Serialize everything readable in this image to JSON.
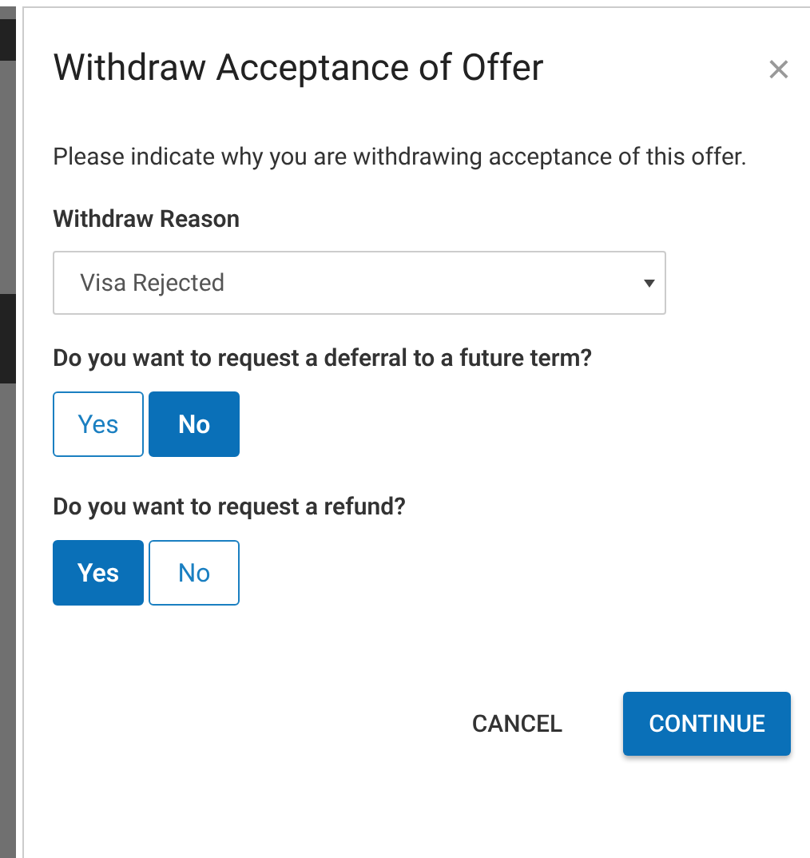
{
  "dialog": {
    "title": "Withdraw Acceptance of Offer",
    "close": "×",
    "intro": "Please indicate why you are withdrawing acceptance of this offer.",
    "reason": {
      "label": "Withdraw Reason",
      "value": "Visa Rejected"
    },
    "questions": [
      {
        "label": "Do you want to request a deferral to a future term?",
        "options": [
          {
            "label": "Yes",
            "selected": false
          },
          {
            "label": "No",
            "selected": true
          }
        ]
      },
      {
        "label": "Do you want to request a refund?",
        "options": [
          {
            "label": "Yes",
            "selected": true
          },
          {
            "label": "No",
            "selected": false
          }
        ]
      }
    ],
    "buttons": [
      {
        "label": "CANCEL",
        "kind": "flat"
      },
      {
        "label": "CONTINUE",
        "kind": "primary"
      }
    ]
  }
}
